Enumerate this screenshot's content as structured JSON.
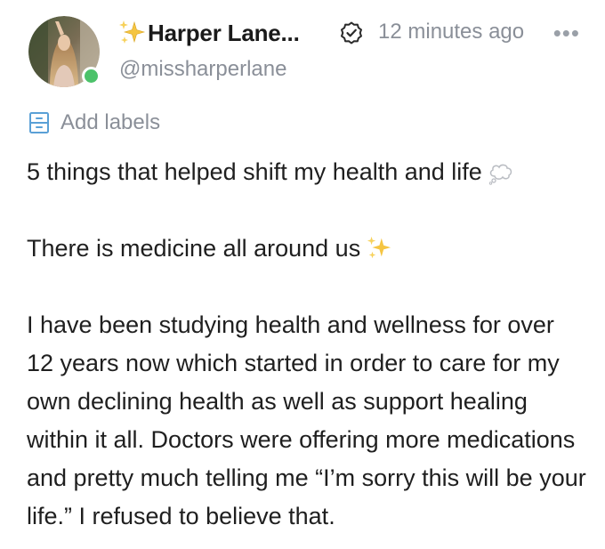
{
  "user": {
    "display_name": "Harper Lane...",
    "handle": "@missharperlane",
    "online": true,
    "name_prefix_icon": "sparkles-icon",
    "badge_icon": "verified-badge-icon"
  },
  "meta": {
    "timestamp": "12 minutes ago",
    "more_icon": "ellipsis-icon",
    "more_label": "•••"
  },
  "labels": {
    "icon": "label-drawer-icon",
    "text": "Add labels"
  },
  "post": {
    "line1": "5 things that helped shift my health and life",
    "line1_emoji": "thought-bubble-icon",
    "line2": "There is medicine all around us",
    "line2_emoji": "sparkles-icon",
    "paragraph": "I have been studying health and wellness for over 12 years now which started in order to care for my own declining health as well as support healing within it all. Doctors were offering more medica­tions and pretty much telling me “I’m sorry this will be your life.” I refused to believe that."
  },
  "colors": {
    "text": "#1f1f1f",
    "muted": "#8a8f98",
    "presence": "#4cc26a",
    "labels_icon": "#5aa0d6",
    "sparkle": "#f5c542"
  }
}
